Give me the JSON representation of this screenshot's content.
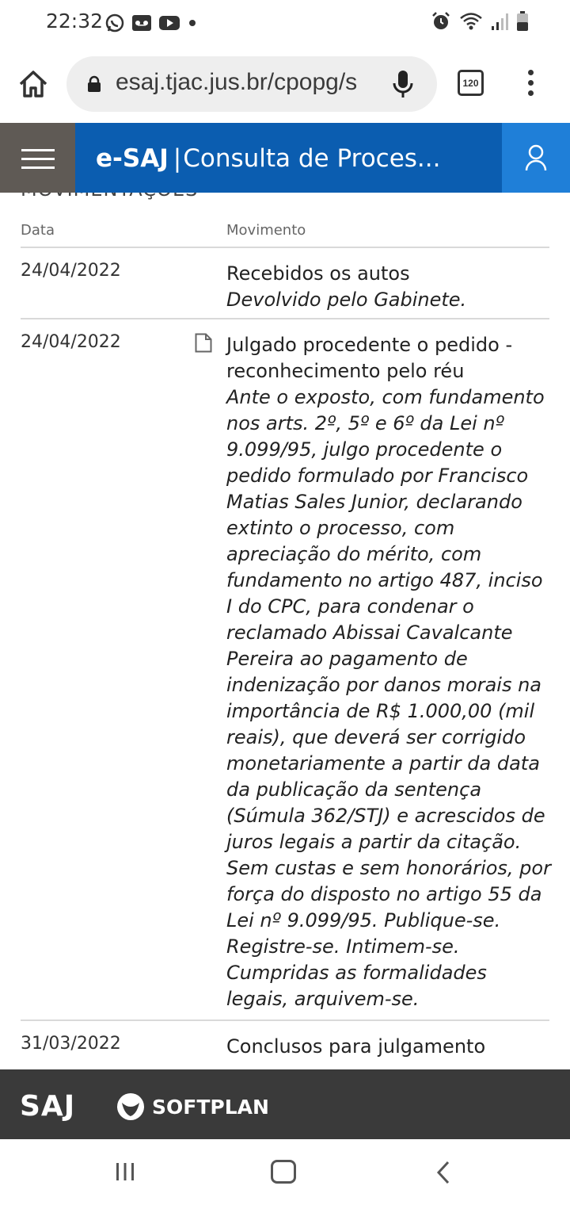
{
  "status_bar": {
    "time": "22:32"
  },
  "browser": {
    "url": "esaj.tjac.jus.br/cpopg/s",
    "tab_count": "120"
  },
  "app_header": {
    "brand": "e-SAJ",
    "separator": "|",
    "subtitle": "Consulta de Proces..."
  },
  "section": {
    "title": "MOVIMENTAÇÕES",
    "col_date": "Data",
    "col_movement": "Movimento"
  },
  "movements": [
    {
      "date": "24/04/2022",
      "title": "Recebidos os autos",
      "description": "Devolvido pelo Gabinete."
    },
    {
      "date": "24/04/2022",
      "title": "Julgado procedente o pedido - reconhecimento pelo réu",
      "description": "Ante o exposto, com fundamento nos arts. 2º, 5º e 6º da Lei nº 9.099/95, julgo procedente o pedido formulado por Francisco Matias Sales Junior, declarando extinto o processo, com apreciação do mérito, com fundamento no artigo 487, inciso I do CPC, para condenar o reclamado Abissai Cavalcante Pereira ao pagamento de indenização por danos morais na importância de R$ 1.000,00 (mil reais), que deverá ser corrigido monetariamente a partir da data da publicação da sentença (Súmula 362/STJ) e acrescidos de juros legais a partir da citação. Sem custas e sem honorários, por força do disposto no artigo 55 da Lei nº 9.099/95. Publique-se. Registre-se. Intimem-se. Cumpridas as formalidades legais, arquivem-se."
    },
    {
      "date": "31/03/2022",
      "title": "Conclusos para julgamento"
    }
  ],
  "footer": {
    "saj_logo": "SAJ",
    "softplan_logo": "SOFTPLAN"
  }
}
